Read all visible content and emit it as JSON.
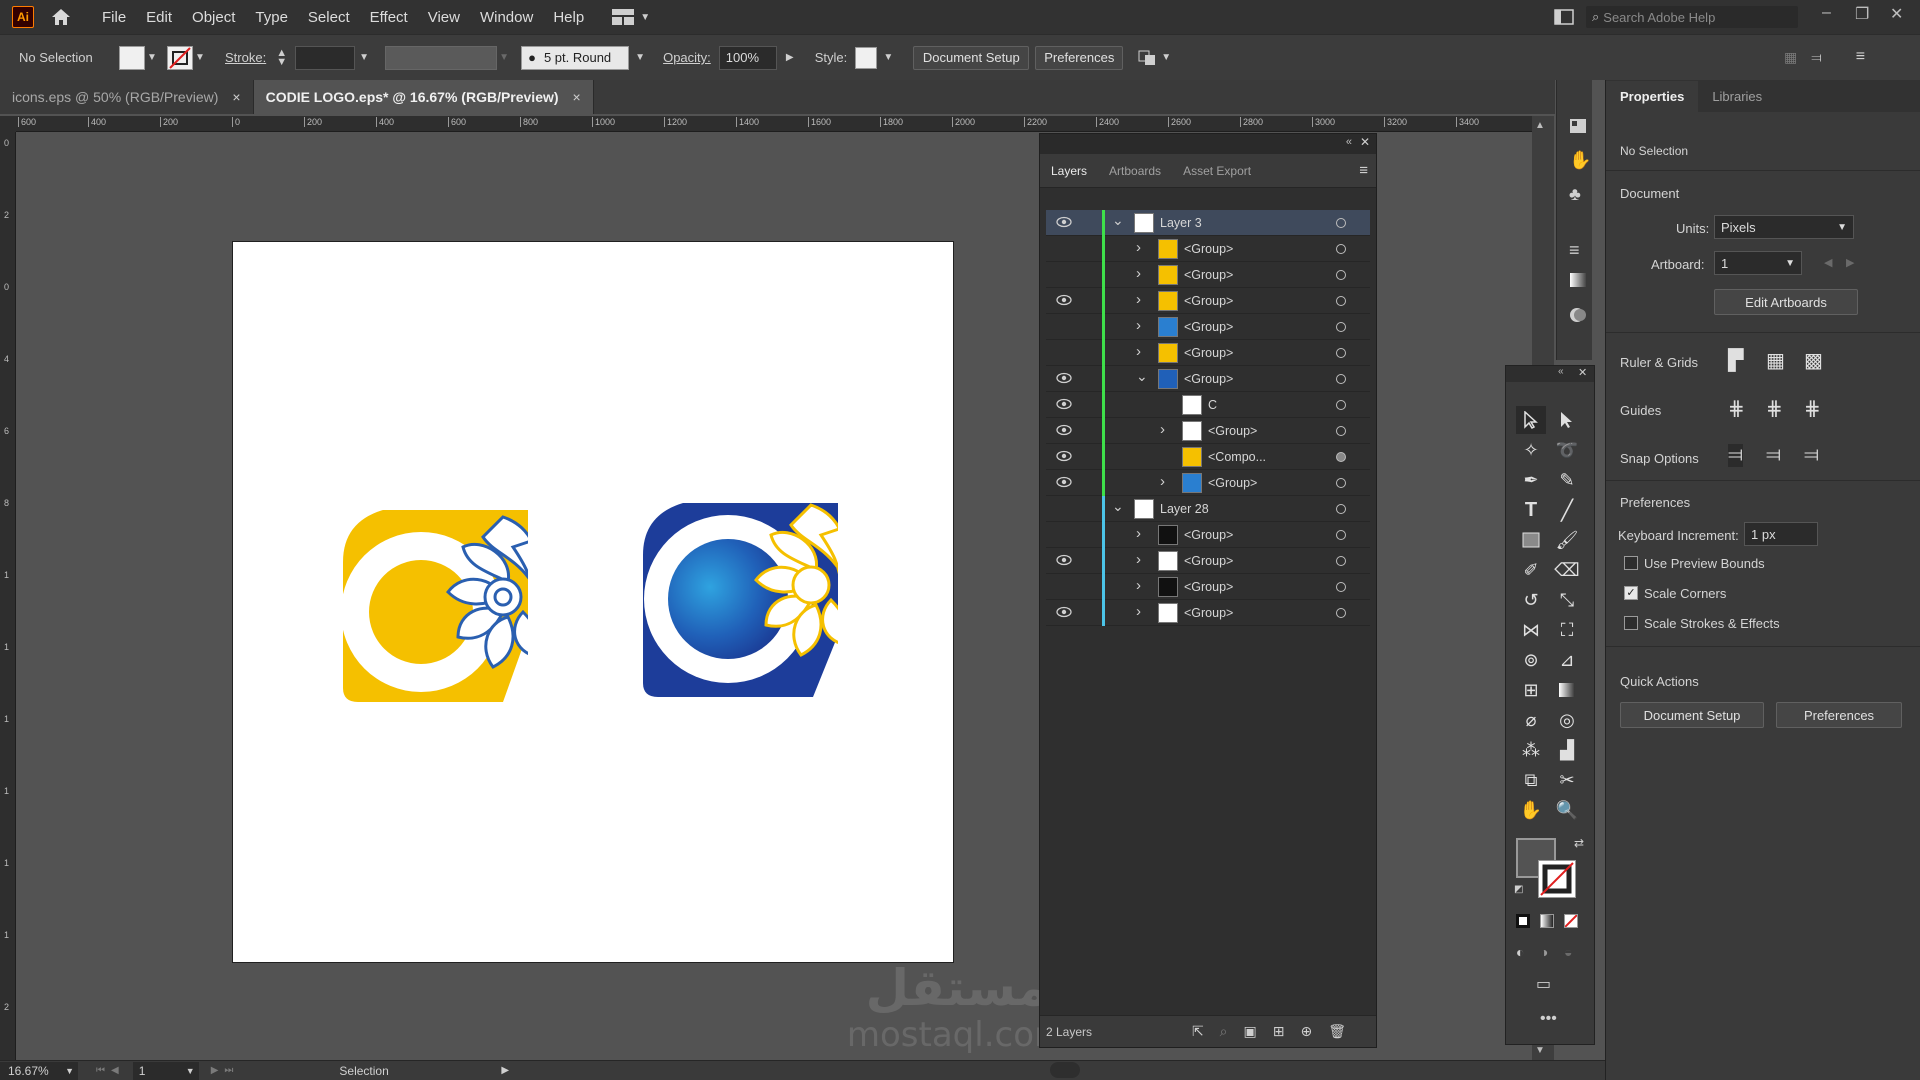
{
  "app": {
    "logo": "Ai",
    "menu": [
      "File",
      "Edit",
      "Object",
      "Type",
      "Select",
      "Effect",
      "View",
      "Window",
      "Help"
    ],
    "search_placeholder": "Search Adobe Help"
  },
  "control": {
    "selection": "No Selection",
    "stroke_label": "Stroke:",
    "brush": "5 pt. Round",
    "opacity_label": "Opacity:",
    "opacity_value": "100%",
    "style_label": "Style:",
    "document_setup": "Document Setup",
    "preferences": "Preferences"
  },
  "tabs": [
    {
      "label": "icons.eps @ 50% (RGB/Preview)",
      "close": "×"
    },
    {
      "label": "CODIE LOGO.eps* @ 16.67% (RGB/Preview)",
      "close": "×"
    }
  ],
  "ruler": {
    "h_ticks": [
      "600",
      "400",
      "200",
      "0",
      "200",
      "400",
      "600",
      "800",
      "1000",
      "1200",
      "1400",
      "1600",
      "1800",
      "2000",
      "2200",
      "2400",
      "2600",
      "2800",
      "3000",
      "3200",
      "3400"
    ],
    "v_ticks": [
      "0",
      "2",
      "0",
      "4",
      "6",
      "8",
      "1",
      "1",
      "1",
      "1",
      "1",
      "1",
      "2"
    ]
  },
  "layers_panel": {
    "tabs": [
      "Layers",
      "Artboards",
      "Asset Export"
    ],
    "footer_count": "2 Layers",
    "rows": [
      {
        "name": "Layer 3",
        "level": 0,
        "expanded": true,
        "eye": true,
        "color": "#3ee04a"
      },
      {
        "name": "<Group>",
        "level": 1,
        "expanded": false,
        "eye": false,
        "color": "#3ee04a"
      },
      {
        "name": "<Group>",
        "level": 1,
        "expanded": false,
        "eye": false,
        "color": "#3ee04a"
      },
      {
        "name": "<Group>",
        "level": 1,
        "expanded": false,
        "eye": true,
        "color": "#3ee04a"
      },
      {
        "name": "<Group>",
        "level": 1,
        "expanded": false,
        "eye": false,
        "color": "#3ee04a"
      },
      {
        "name": "<Group>",
        "level": 1,
        "expanded": false,
        "eye": false,
        "color": "#3ee04a"
      },
      {
        "name": "<Group>",
        "level": 1,
        "expanded": true,
        "eye": true,
        "color": "#3ee04a"
      },
      {
        "name": "C",
        "level": 2,
        "expanded": null,
        "eye": true,
        "color": "#3ee04a"
      },
      {
        "name": "<Group>",
        "level": 2,
        "expanded": false,
        "eye": true,
        "color": "#3ee04a"
      },
      {
        "name": "<Compo...",
        "level": 2,
        "expanded": null,
        "eye": true,
        "color": "#3ee04a"
      },
      {
        "name": "<Group>",
        "level": 2,
        "expanded": false,
        "eye": true,
        "color": "#3ee04a"
      },
      {
        "name": "Layer 28",
        "level": 0,
        "expanded": true,
        "eye": false,
        "color": "#4cc4e8"
      },
      {
        "name": "<Group>",
        "level": 1,
        "expanded": false,
        "eye": false,
        "color": "#4cc4e8"
      },
      {
        "name": "<Group>",
        "level": 1,
        "expanded": false,
        "eye": true,
        "color": "#4cc4e8"
      },
      {
        "name": "<Group>",
        "level": 1,
        "expanded": false,
        "eye": false,
        "color": "#4cc4e8"
      },
      {
        "name": "<Group>",
        "level": 1,
        "expanded": false,
        "eye": true,
        "color": "#4cc4e8"
      }
    ]
  },
  "properties": {
    "tabs": [
      "Properties",
      "Libraries"
    ],
    "no_selection": "No Selection",
    "document": "Document",
    "units_label": "Units:",
    "units_value": "Pixels",
    "artboard_label": "Artboard:",
    "artboard_value": "1",
    "edit_artboards": "Edit Artboards",
    "ruler_grids": "Ruler & Grids",
    "guides": "Guides",
    "snap_options": "Snap Options",
    "preferences": "Preferences",
    "keyboard_increment_label": "Keyboard Increment:",
    "keyboard_increment_value": "1 px",
    "checks": [
      {
        "label": "Use Preview Bounds",
        "checked": false
      },
      {
        "label": "Scale Corners",
        "checked": true
      },
      {
        "label": "Scale Strokes & Effects",
        "checked": false
      }
    ],
    "quick_actions": "Quick Actions",
    "qa_document_setup": "Document Setup",
    "qa_preferences": "Preferences"
  },
  "status": {
    "zoom": "16.67%",
    "artboard": "1",
    "tool": "Selection"
  },
  "watermark": {
    "arabic": "مستقل",
    "latin": "mostaql.com"
  },
  "colors": {
    "yellow": "#f5c000",
    "blue_dark": "#1d3d9a",
    "blue_light": "#2c8fd6",
    "accent_green": "#3ee04a",
    "accent_cyan": "#4cc4e8"
  }
}
